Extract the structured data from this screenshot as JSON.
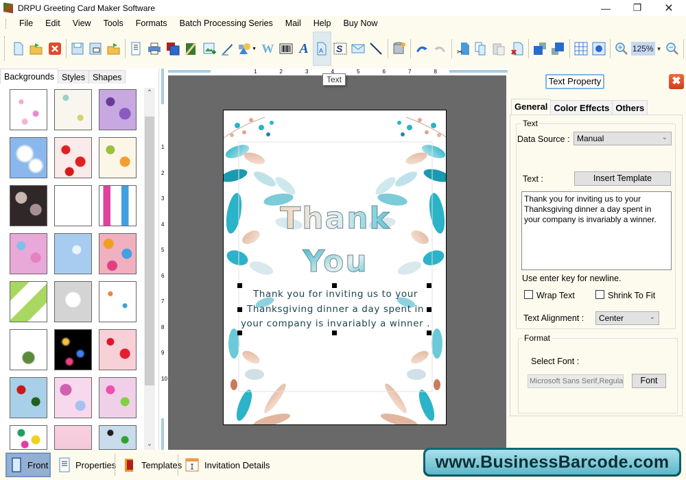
{
  "window": {
    "title": "DRPU Greeting Card Maker Software",
    "controls": [
      "minimize",
      "restore",
      "close"
    ]
  },
  "menu": [
    "File",
    "Edit",
    "View",
    "Tools",
    "Formats",
    "Batch Processing Series",
    "Mail",
    "Help",
    "Buy Now"
  ],
  "toolbar": {
    "icons": [
      "new-icon",
      "open-icon",
      "close-icon",
      "save-icon",
      "save-as-icon",
      "open-folder-icon",
      "properties-icon",
      "print-icon",
      "copy-card-icon",
      "card-back-icon",
      "insert-image-icon",
      "signature-icon",
      "shapes-icon",
      "watermark-icon",
      "barcode-icon",
      "wordart-icon",
      "text-icon",
      "symbol-icon",
      "email-icon",
      "line-icon",
      "database-icon",
      "undo-icon",
      "redo-icon",
      "cut-icon",
      "copy-icon",
      "paste-icon",
      "delete-icon",
      "bring-front-icon",
      "send-back-icon",
      "grid-icon",
      "fit-icon",
      "zoom-in-icon",
      "zoom-out-icon"
    ],
    "zoom_value": "125%",
    "tooltip": "Text"
  },
  "left_panel": {
    "tabs": [
      "Backgrounds",
      "Styles",
      "Shapes"
    ],
    "selected_tab": "Backgrounds",
    "thumbnails": [
      "baby-doodles",
      "baby-sketches",
      "purple-flowers",
      "blue-sky-clouds",
      "strawberries",
      "colorful-leaves",
      "dark-roses",
      "white-floral-frame",
      "gift-boxes",
      "pastel-flowers",
      "blue-snowflakes",
      "colorful-circles",
      "green-trees",
      "white-heart",
      "kids-pattern",
      "green-ornament",
      "fireworks",
      "red-hearts",
      "santa-pattern",
      "pink-florals",
      "pink-butterflies",
      "colorful-stars",
      "pink-texture",
      "snowman-pattern"
    ]
  },
  "rulers": {
    "horizontal": [
      "1",
      "2",
      "3",
      "4",
      "5",
      "6",
      "7",
      "8"
    ],
    "vertical": [
      "1",
      "2",
      "3",
      "4",
      "5",
      "6",
      "7",
      "8",
      "9",
      "10"
    ]
  },
  "card": {
    "title_line1": "Thank",
    "title_line2": "You",
    "message_lines": [
      "Thank you for inviting us to your",
      "Thanksgiving dinner a day spent in",
      "your company is invariably a winner ."
    ]
  },
  "right_panel": {
    "header": "Text Property",
    "tabs": [
      "General",
      "Color Effects",
      "Others"
    ],
    "selected_tab": "General",
    "text_group_label": "Text",
    "data_source_label": "Data Source :",
    "data_source_value": "Manual",
    "text_label": "Text :",
    "insert_template_label": "Insert Template",
    "text_value": "Thank you for inviting us to your Thanksgiving dinner a day spent in your company is invariably a winner.",
    "hint": "Use enter key for newline.",
    "wrap_text_label": "Wrap Text",
    "wrap_text_checked": false,
    "shrink_to_fit_label": "Shrink To Fit",
    "shrink_to_fit_checked": false,
    "alignment_label": "Text Alignment :",
    "alignment_value": "Center",
    "format_group_label": "Format",
    "select_font_label": "Select Font :",
    "font_value": "Microsoft Sans Serif,Regular",
    "font_button_label": "Font"
  },
  "bottom_tabs": [
    {
      "label": "Front",
      "selected": true
    },
    {
      "label": "Properties",
      "selected": false
    },
    {
      "label": "Templates",
      "selected": false
    },
    {
      "label": "Invitation Details",
      "selected": false
    }
  ],
  "brand": "www.BusinessBarcode.com",
  "colors": {
    "background": "#fdfbee",
    "canvas": "#696969",
    "accent_teal": "#2bb3c7",
    "brand_dark": "#0c2e36",
    "close_red": "#e0502a"
  }
}
